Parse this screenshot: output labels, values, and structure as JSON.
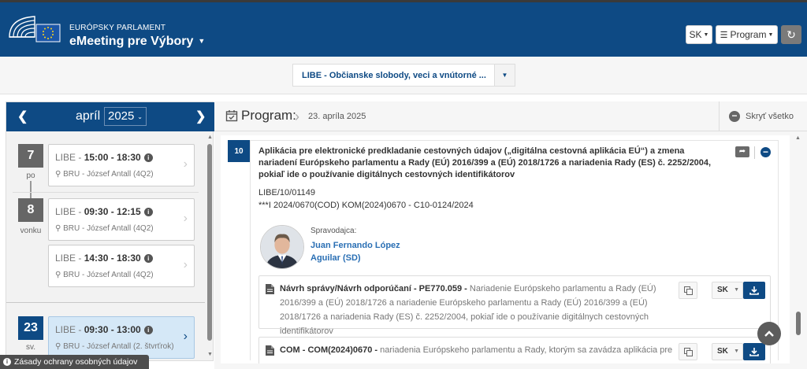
{
  "header": {
    "org": "EURÓPSKY PARLAMENT",
    "app_title": "eMeeting pre Výbory",
    "lang_button": "SK",
    "program_button": "Program",
    "colors": {
      "primary": "#0e4a84",
      "accent": "#2a6fb4"
    }
  },
  "committee_select": {
    "value": "LIBE - Občianske slobody, veci a vnútorné ..."
  },
  "calendar": {
    "month": "apríl",
    "year": "2025",
    "days": [
      {
        "num": "7",
        "label": "po",
        "meetings": [
          {
            "committee": "LIBE",
            "time": "15:00 - 18:30",
            "location": "BRU - József Antall (4Q2)"
          }
        ]
      },
      {
        "num": "8",
        "label": "vonku",
        "meetings": [
          {
            "committee": "LIBE",
            "time": "09:30 - 12:15",
            "location": "BRU - József Antall (4Q2)"
          },
          {
            "committee": "LIBE",
            "time": "14:30 - 18:30",
            "location": "BRU - József Antall (4Q2)"
          }
        ]
      },
      {
        "num": "23",
        "label": "sv.",
        "meetings": [
          {
            "committee": "LIBE",
            "time": "09:30 - 13:00",
            "location": "BRU - József Antall (2. štvrťrok)"
          }
        ]
      }
    ]
  },
  "program": {
    "title": "Program:",
    "date": "23. apríla 2025",
    "hide_all": "Skryť všetko",
    "item": {
      "number": "10",
      "title": "Aplikácia pre elektronické predkladanie cestovných údajov („digitálna cestovná aplikácia EÚ“) a zmena nariadení Európskeho parlamentu a Rady (EÚ) 2016/399 a (EÚ) 2018/1726 a nariadenia Rady (ES) č. 2252/2004, pokiaľ ide o používanie digitálnych cestovných identifikátorov",
      "ref1": "LIBE/10/01149",
      "ref2": "***I 2024/0670(COD) KOM(2024)0670 - C10-0124/2024",
      "rapporteur_label": "Spravodajca:",
      "rapporteur_name": "Juan Fernando López",
      "rapporteur_group": "Aguilar (SD)",
      "documents": [
        {
          "title": "Návrh správy/Návrh odporúčaní - PE770.059 -",
          "desc": " Nariadenie Európskeho parlamentu a Rady (EÚ) 2016/399 a (EÚ) 2018/1726 a nariadenie Európskeho parlamentu a Rady (EÚ) 2016/399 a (EÚ) 2018/1726 a nariadenia Rady (ES) č. 2252/2004, pokiaľ ide o používanie digitálnych cestovných identifikátorov",
          "lang": "SK"
        },
        {
          "title": "COM - COM(2024)0670 -",
          "desc": " nariadenia Európskeho parlamentu a Rady, ktorým sa zavádza aplikácia pre",
          "lang": "SK"
        }
      ]
    }
  },
  "footer": {
    "privacy": "Zásady ochrany osobných údajov"
  }
}
